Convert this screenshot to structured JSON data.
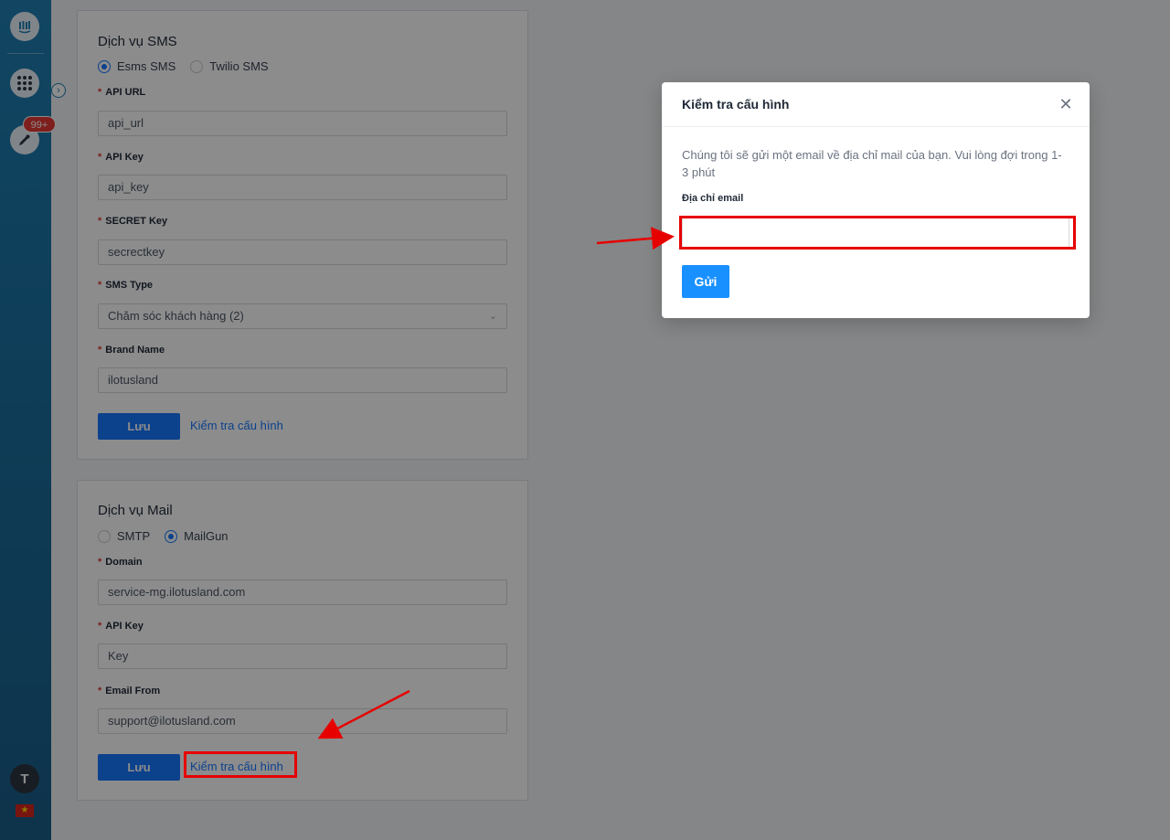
{
  "sidebar": {
    "badge_count": "99+",
    "avatar_initial": "T",
    "flag_glyph": "★"
  },
  "sms_card": {
    "title": "Dịch vụ SMS",
    "radios": [
      {
        "label": "Esms SMS",
        "selected": true
      },
      {
        "label": "Twilio SMS",
        "selected": false
      }
    ],
    "fields": [
      {
        "label": "API URL",
        "value": "api_url"
      },
      {
        "label": "API Key",
        "value": "api_key"
      },
      {
        "label": "SECRET Key",
        "value": "secrectkey"
      },
      {
        "label": "SMS Type",
        "value": "Chăm sóc khách hàng (2)"
      },
      {
        "label": "Brand Name",
        "value": "ilotusland"
      }
    ],
    "save_label": "Lưu",
    "test_link": "Kiểm tra cấu hình"
  },
  "mail_card": {
    "title": "Dịch vụ Mail",
    "radios": [
      {
        "label": "SMTP",
        "selected": false
      },
      {
        "label": "MailGun",
        "selected": true
      }
    ],
    "fields": [
      {
        "label": "Domain",
        "value": "service-mg.ilotusland.com"
      },
      {
        "label": "API Key",
        "value": "Key"
      },
      {
        "label": "Email From",
        "value": "support@ilotusland.com"
      }
    ],
    "save_label": "Lưu",
    "test_link": "Kiểm tra cấu hình"
  },
  "modal": {
    "title": "Kiểm tra cấu hình",
    "description": "Chúng tôi sẽ gửi một email về địa chỉ mail của bạn. Vui lòng đợi trong 1-3 phút",
    "email_label": "Địa chỉ email",
    "email_value": "",
    "send_label": "Gửi",
    "close_glyph": "✕"
  },
  "colors": {
    "primary": "#1677ff",
    "required": "#e53935",
    "annotation": "#e60000",
    "sidebar": "#1f7fb2"
  }
}
